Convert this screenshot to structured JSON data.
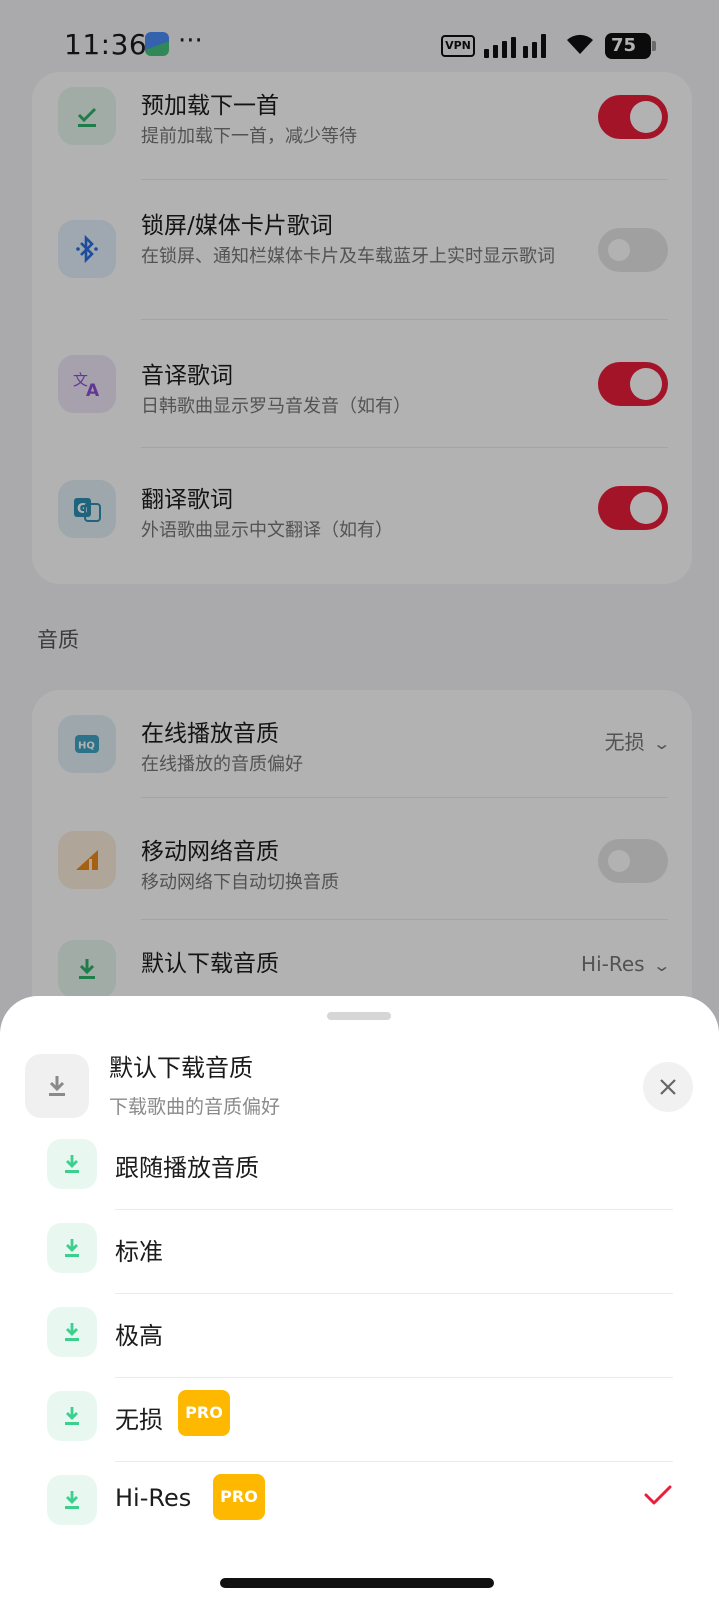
{
  "status_bar": {
    "time": "11:36",
    "dots": "···",
    "vpn": "VPN",
    "battery": "75"
  },
  "settings": {
    "rows": [
      {
        "title": "预加载下一首",
        "subtitle": "提前加载下一首，减少等待",
        "toggle": true,
        "icon": "check-download-icon"
      },
      {
        "title": "锁屏/媒体卡片歌词",
        "subtitle": "在锁屏、通知栏媒体卡片及车载蓝牙上实时显示歌词",
        "toggle": false,
        "icon": "bluetooth-icon"
      },
      {
        "title": "音译歌词",
        "subtitle": "日韩歌曲显示罗马音发音（如有）",
        "toggle": true,
        "icon": "transliterate-icon"
      },
      {
        "title": "翻译歌词",
        "subtitle": "外语歌曲显示中文翻译（如有）",
        "toggle": true,
        "icon": "translate-icon"
      }
    ],
    "quality_section_label": "音质",
    "quality_rows": [
      {
        "title": "在线播放音质",
        "subtitle": "在线播放的音质偏好",
        "value": "无损",
        "icon": "hq-icon"
      },
      {
        "title": "移动网络音质",
        "subtitle": "移动网络下自动切换音质",
        "toggle": false,
        "icon": "signal-icon"
      },
      {
        "title": "默认下载音质",
        "value": "Hi-Res",
        "icon": "download-icon"
      }
    ]
  },
  "sheet": {
    "title": "默认下载音质",
    "subtitle": "下载歌曲的音质偏好",
    "options": [
      {
        "label": "跟随播放音质",
        "pro": false,
        "selected": false
      },
      {
        "label": "标准",
        "pro": false,
        "selected": false
      },
      {
        "label": "极高",
        "pro": false,
        "selected": false
      },
      {
        "label": "无损",
        "pro": true,
        "selected": false
      },
      {
        "label": "Hi-Res",
        "pro": true,
        "selected": true
      }
    ],
    "pro_label": "PRO"
  },
  "colors": {
    "accent": "#ea1e3c",
    "pro_badge": "#ffb800",
    "download_icon_green": "#3ccf8e"
  }
}
